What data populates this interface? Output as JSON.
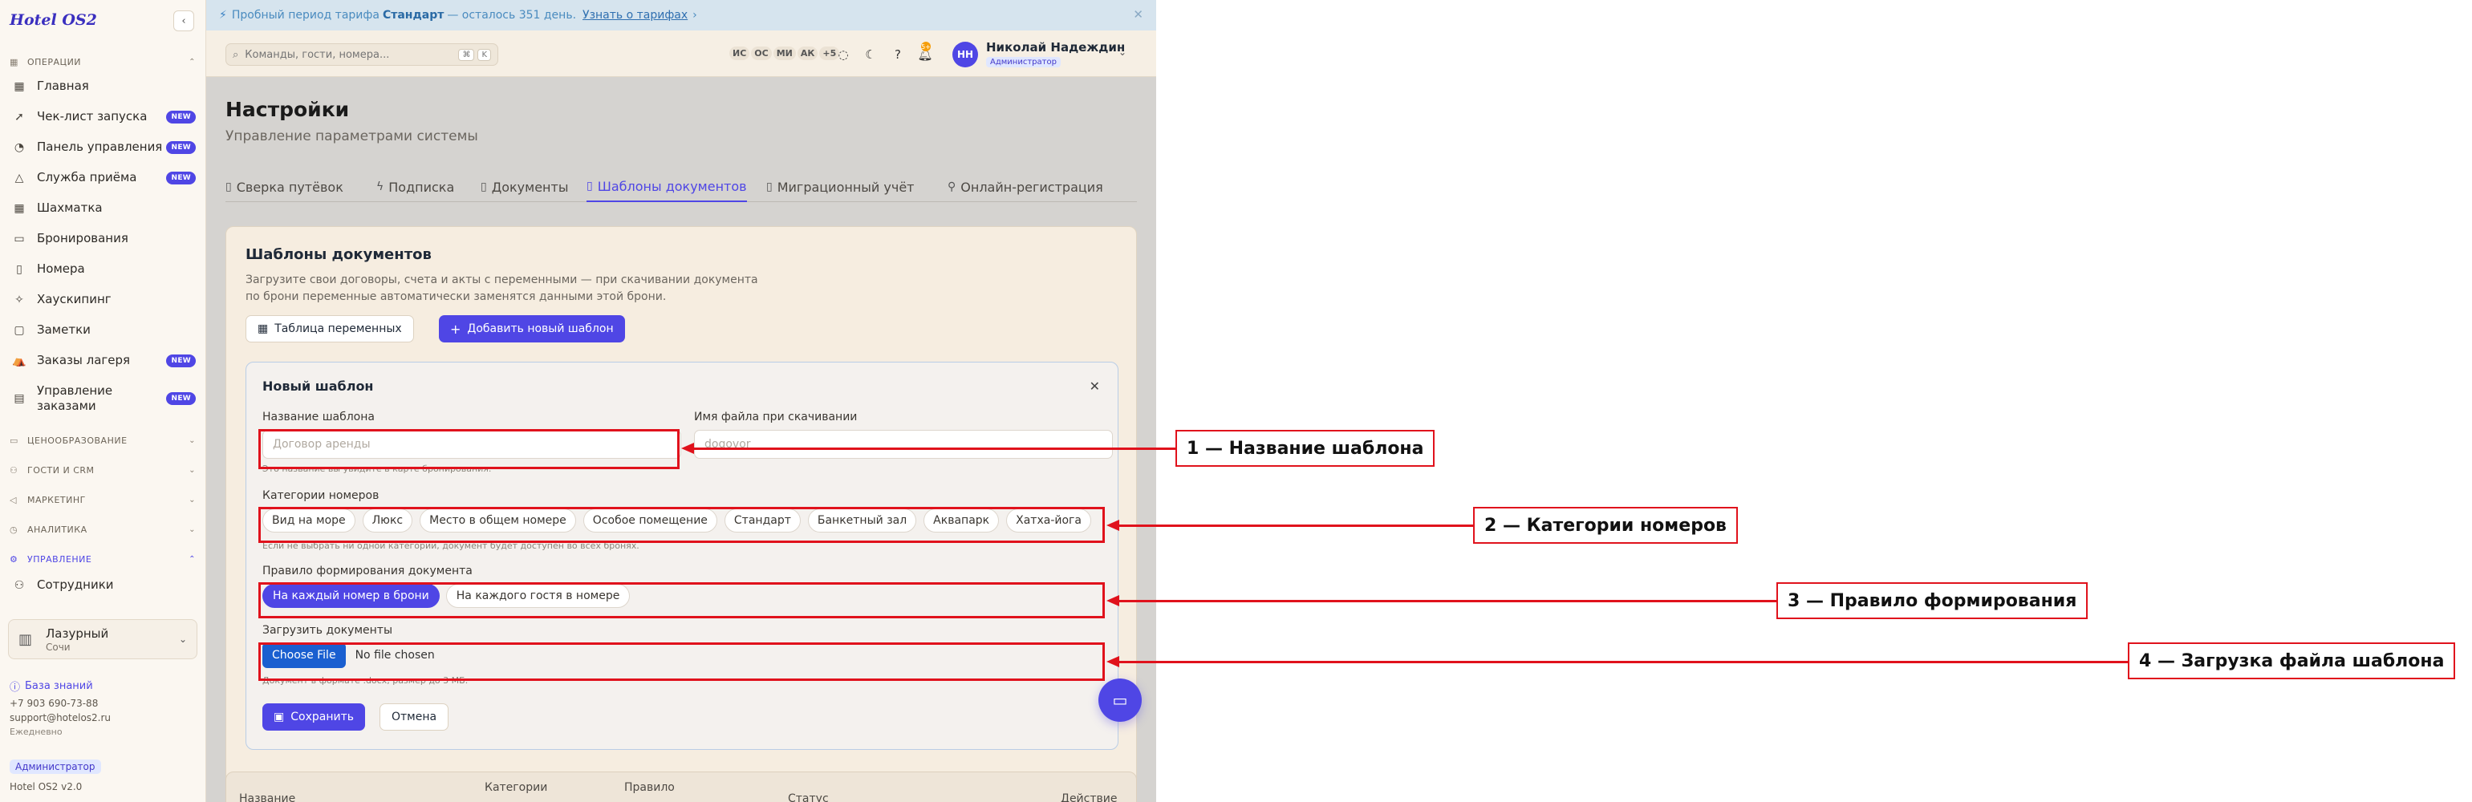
{
  "sidebar": {
    "brand": "Hotel OS2",
    "collapse_icon": "chevron-left-icon",
    "sections": {
      "operations": "ОПЕРАЦИИ",
      "pricing": "ЦЕНООБРАЗОВАНИЕ",
      "guests_crm": "ГОСТИ И CRM",
      "marketing": "МАРКЕТИНГ",
      "analytics": "АНАЛИТИКА",
      "management": "УПРАВЛЕНИЕ"
    },
    "items": [
      {
        "label": "Главная",
        "icon": "dashboard-icon",
        "badge": ""
      },
      {
        "label": "Чек-лист запуска",
        "icon": "rocket-icon",
        "badge": "NEW"
      },
      {
        "label": "Панель управления",
        "icon": "gauge-icon",
        "badge": "NEW"
      },
      {
        "label": "Служба приёма",
        "icon": "bell-icon",
        "badge": "NEW"
      },
      {
        "label": "Шахматка",
        "icon": "grid-icon",
        "badge": ""
      },
      {
        "label": "Бронирования",
        "icon": "book-icon",
        "badge": ""
      },
      {
        "label": "Номера",
        "icon": "door-icon",
        "badge": ""
      },
      {
        "label": "Хаускипинг",
        "icon": "broom-icon",
        "badge": ""
      },
      {
        "label": "Заметки",
        "icon": "note-icon",
        "badge": ""
      },
      {
        "label": "Заказы лагеря",
        "icon": "tent-icon",
        "badge": "NEW"
      },
      {
        "label": "Управление заказами",
        "icon": "clipboard-icon",
        "badge": "NEW"
      }
    ],
    "management_items": [
      {
        "label": "Сотрудники",
        "icon": "users-icon"
      }
    ],
    "hotel": {
      "name": "Лазурный",
      "city": "Сочи"
    },
    "knowledge_base": "База знаний",
    "phone": "+7 903 690-73-88",
    "email": "support@hotelos2.ru",
    "hours": "Ежедневно",
    "role": "Администратор",
    "version": "Hotel OS2 v2.0"
  },
  "banner": {
    "prefix": "Пробный период тарифа",
    "plan": "Стандарт",
    "suffix": "— осталось 351 день.",
    "link": "Узнать о тарифах",
    "arrow": "›",
    "close": "✕"
  },
  "header": {
    "search_placeholder": "Команды, гости, номера...",
    "shortcut_1": "⌘",
    "shortcut_2": "K",
    "presence": [
      "ИС",
      "ОС",
      "МИ",
      "АК",
      "+5"
    ],
    "notification_count": "5+",
    "user_initials": "НН",
    "user_name": "Николай Надеждин",
    "user_role": "Администратор"
  },
  "page": {
    "title": "Настройки",
    "subtitle": "Управление параметрами системы"
  },
  "tabs": [
    {
      "label": "Сверка путёвок",
      "icon": "document-check-icon",
      "active": false
    },
    {
      "label": "Подписка",
      "icon": "bolt-icon",
      "active": false
    },
    {
      "label": "Документы",
      "icon": "document-icon",
      "active": false
    },
    {
      "label": "Шаблоны документов",
      "icon": "document-template-icon",
      "active": true
    },
    {
      "label": "Миграционный учёт",
      "icon": "document-list-icon",
      "active": false
    },
    {
      "label": "Онлайн-регистрация",
      "icon": "user-plus-icon",
      "active": false
    }
  ],
  "templates_panel": {
    "title": "Шаблоны документов",
    "description": "Загрузите свои договоры, счета и акты с переменными — при скачивании документа по брони переменные автоматически заменятся данными этой брони.",
    "variables_button": "Таблица переменных",
    "add_button": "Добавить новый шаблон"
  },
  "new_template": {
    "title": "Новый шаблон",
    "name_label": "Название шаблона",
    "name_placeholder": "Договор аренды",
    "name_hint": "Это название вы увидите в карте бронирования.",
    "filename_label": "Имя файла при скачивании",
    "filename_placeholder": "dogovor",
    "categories_label": "Категории номеров",
    "categories": [
      "Вид на море",
      "Люкс",
      "Место в общем номере",
      "Особое помещение",
      "Стандарт",
      "Банкетный зал",
      "Аквапарк",
      "Хатха-йога"
    ],
    "categories_hint": "Если не выбрать ни одной категории, документ будет доступен во всех бронях.",
    "rule_label": "Правило формирования документа",
    "rules": [
      {
        "label": "На каждый номер в брони",
        "active": true
      },
      {
        "label": "На каждого гостя в номере",
        "active": false
      }
    ],
    "upload_label": "Загрузить документы",
    "file_button": "Choose File",
    "file_status": "No file chosen",
    "upload_hint": "Документ в формате .docx, размер до 3 МБ.",
    "save_button": "Сохранить",
    "cancel_button": "Отмена"
  },
  "table": {
    "columns": [
      "Название",
      "Категории",
      "Правило",
      "Статус",
      "Действие"
    ]
  },
  "callouts": [
    {
      "label": "1 — Название шаблона"
    },
    {
      "label": "2 — Категории номеров"
    },
    {
      "label": "3 — Правило формирования"
    },
    {
      "label": "4 — Загрузка файла шаблона"
    }
  ],
  "colors": {
    "accent": "#4f46e5",
    "callout": "#e0121c",
    "banner_bg": "#d6e4ee",
    "sidebar_bg": "#fbf7f1"
  }
}
